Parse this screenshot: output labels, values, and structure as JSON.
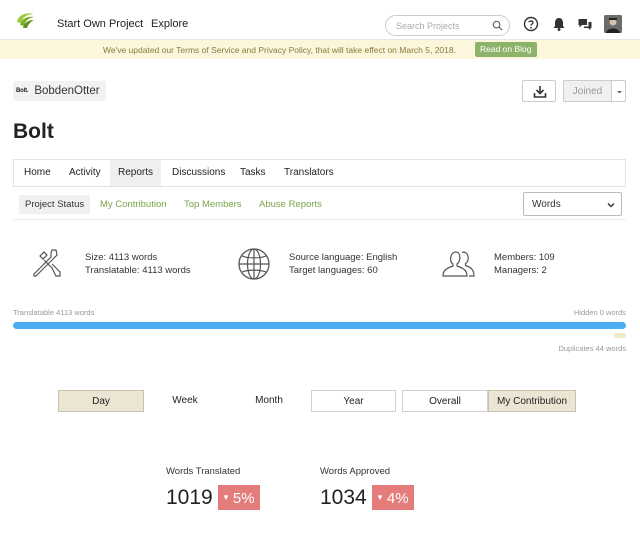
{
  "nav": {
    "start_project": "Start Own Project",
    "explore": "Explore",
    "search_placeholder": "Search Projects"
  },
  "banner": {
    "text": "We've updated our Terms of Service and Privacy Policy, that will take effect on March 5, 2018.",
    "button": "Read on Blog"
  },
  "owner": {
    "logo_text": "Bolt.",
    "name": "BobdenOtter"
  },
  "actions": {
    "joined": "Joined"
  },
  "project": {
    "title": "Bolt"
  },
  "tabs": [
    {
      "label": "Home"
    },
    {
      "label": "Activity"
    },
    {
      "label": "Reports"
    },
    {
      "label": "Discussions"
    },
    {
      "label": "Tasks"
    },
    {
      "label": "Translators"
    }
  ],
  "subtabs": [
    {
      "label": "Project Status"
    },
    {
      "label": "My Contribution"
    },
    {
      "label": "Top Members"
    },
    {
      "label": "Abuse Reports"
    }
  ],
  "units_select": {
    "value": "Words"
  },
  "stats": {
    "size": "Size: 4113 words",
    "translatable": "Translatable: 4113 words",
    "source_language": "Source language: English",
    "target_languages": "Target languages: 60",
    "members": "Members: 109",
    "managers": "Managers: 2"
  },
  "progress": {
    "translatable_label": "Translatable 4113 words",
    "hidden_label": "Hidden 0 words",
    "duplicates_label": "Duplicates 44 words",
    "translatable_fraction": 1.0
  },
  "periods": [
    {
      "label": "Day"
    },
    {
      "label": "Week"
    },
    {
      "label": "Month"
    },
    {
      "label": "Year"
    },
    {
      "label": "Overall"
    },
    {
      "label": "My Contribution"
    }
  ],
  "metrics": {
    "translated": {
      "label": "Words Translated",
      "value": "1019",
      "change": "5%"
    },
    "approved": {
      "label": "Words Approved",
      "value": "1034",
      "change": "4%"
    }
  },
  "colors": {
    "accent_green": "#7aa34a",
    "progress_blue": "#4aaef0",
    "decrease_red": "#e47c7c",
    "banner_bg": "#fbf6dc"
  }
}
